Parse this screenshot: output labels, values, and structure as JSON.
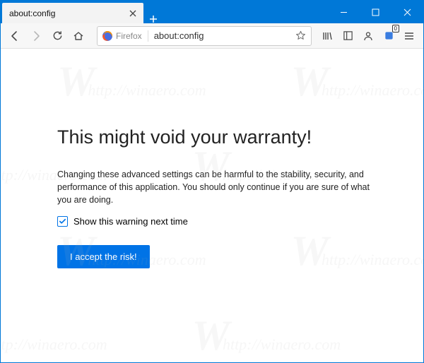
{
  "window": {
    "title": "about:config"
  },
  "tabs": [
    {
      "title": "about:config"
    }
  ],
  "urlbar": {
    "identity_label": "Firefox",
    "url": "about:config"
  },
  "toolbar_icons": {
    "library": "library-icon",
    "sidebars": "sidebars-icon",
    "account": "account-icon",
    "notification": "notification-icon",
    "notification_badge": "0",
    "menu": "menu-icon"
  },
  "page": {
    "heading": "This might void your warranty!",
    "body": "Changing these advanced settings can be harmful to the stability, security, and performance of this application. You should only continue if you are sure of what you are doing.",
    "checkbox_label": "Show this warning next time",
    "checkbox_checked": true,
    "accept_label": "I accept the risk!"
  },
  "watermark": {
    "text": "http://winaero.com"
  }
}
